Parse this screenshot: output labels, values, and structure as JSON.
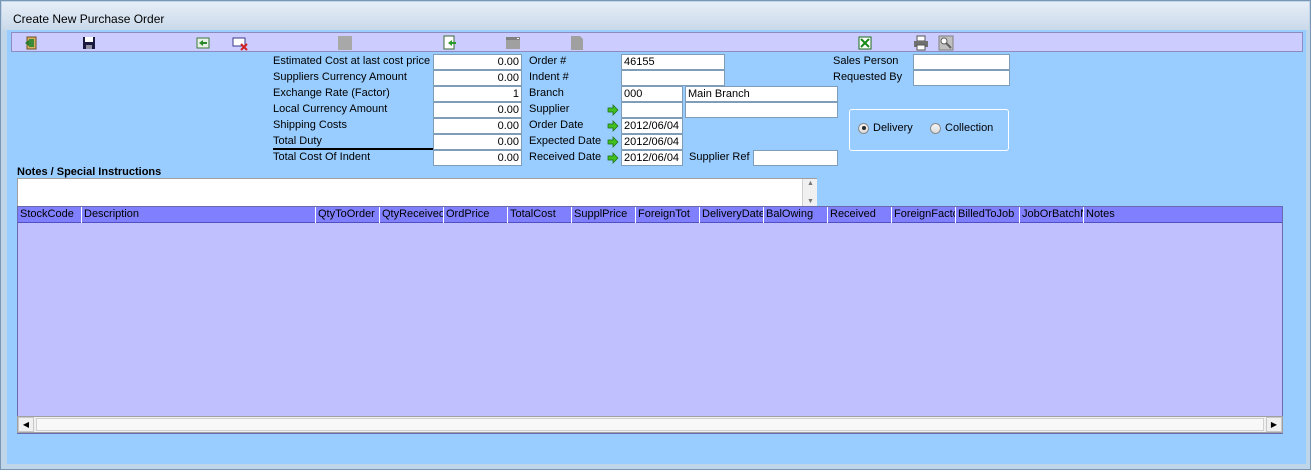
{
  "window": {
    "title": "Create New Purchase Order"
  },
  "toolbar": {
    "buttons": [
      {
        "icon": "exit-icon"
      },
      {
        "icon": "save-icon"
      },
      {
        "icon": "back-icon"
      },
      {
        "icon": "delete-icon"
      },
      {
        "icon": "blank-icon"
      },
      {
        "icon": "import-icon"
      },
      {
        "icon": "window-icon"
      },
      {
        "icon": "page-icon"
      },
      {
        "icon": "excel-icon"
      },
      {
        "icon": "print-icon"
      },
      {
        "icon": "print-preview-icon"
      }
    ]
  },
  "costs": {
    "estimated_cost": {
      "label": "Estimated Cost at last cost price",
      "value": "0.00"
    },
    "suppliers_currency": {
      "label": "Suppliers Currency Amount",
      "value": "0.00"
    },
    "exchange_rate": {
      "label": "Exchange Rate (Factor)",
      "value": "1"
    },
    "local_currency": {
      "label": "Local Currency Amount",
      "value": "0.00"
    },
    "shipping": {
      "label": "Shipping Costs",
      "value": "0.00"
    },
    "total_duty": {
      "label": "Total Duty",
      "value": "0.00"
    },
    "total_cost": {
      "label": "Total Cost Of Indent",
      "value": "0.00"
    }
  },
  "order": {
    "order_no": {
      "label": "Order #",
      "value": "46155"
    },
    "indent_no": {
      "label": "Indent #",
      "value": ""
    },
    "branch": {
      "label": "Branch",
      "code": "000",
      "name": "Main Branch"
    },
    "supplier": {
      "label": "Supplier",
      "code": "",
      "name": ""
    },
    "order_date": {
      "label": "Order Date",
      "value": "2012/06/04"
    },
    "expected_date": {
      "label": "Expected Date",
      "value": "2012/06/04"
    },
    "received_date": {
      "label": "Received Date",
      "value": "2012/06/04"
    },
    "supplier_ref": {
      "label": "Supplier Ref",
      "value": ""
    }
  },
  "people": {
    "sales_person": {
      "label": "Sales Person",
      "value": ""
    },
    "requested_by": {
      "label": "Requested By",
      "value": ""
    }
  },
  "delivery": {
    "options": [
      "Delivery",
      "Collection"
    ],
    "selected": "Delivery"
  },
  "notes": {
    "title": "Notes / Special Instructions",
    "value": ""
  },
  "grid": {
    "columns": [
      "StockCode",
      "Description",
      "QtyToOrder",
      "QtyReceived",
      "OrdPrice",
      "TotalCost",
      "SupplPrice",
      "ForeignTot",
      "DeliveryDate",
      "BalOwing",
      "Received",
      "ForeignFactor",
      "BilledToJob",
      "JobOrBatchNo",
      "Notes"
    ],
    "rows": []
  },
  "colors": {
    "client_bg": "#99ccff",
    "toolbar_bg": "#ccccff",
    "grid_bg": "#c0c0ff",
    "grid_header": "#8080ff"
  }
}
